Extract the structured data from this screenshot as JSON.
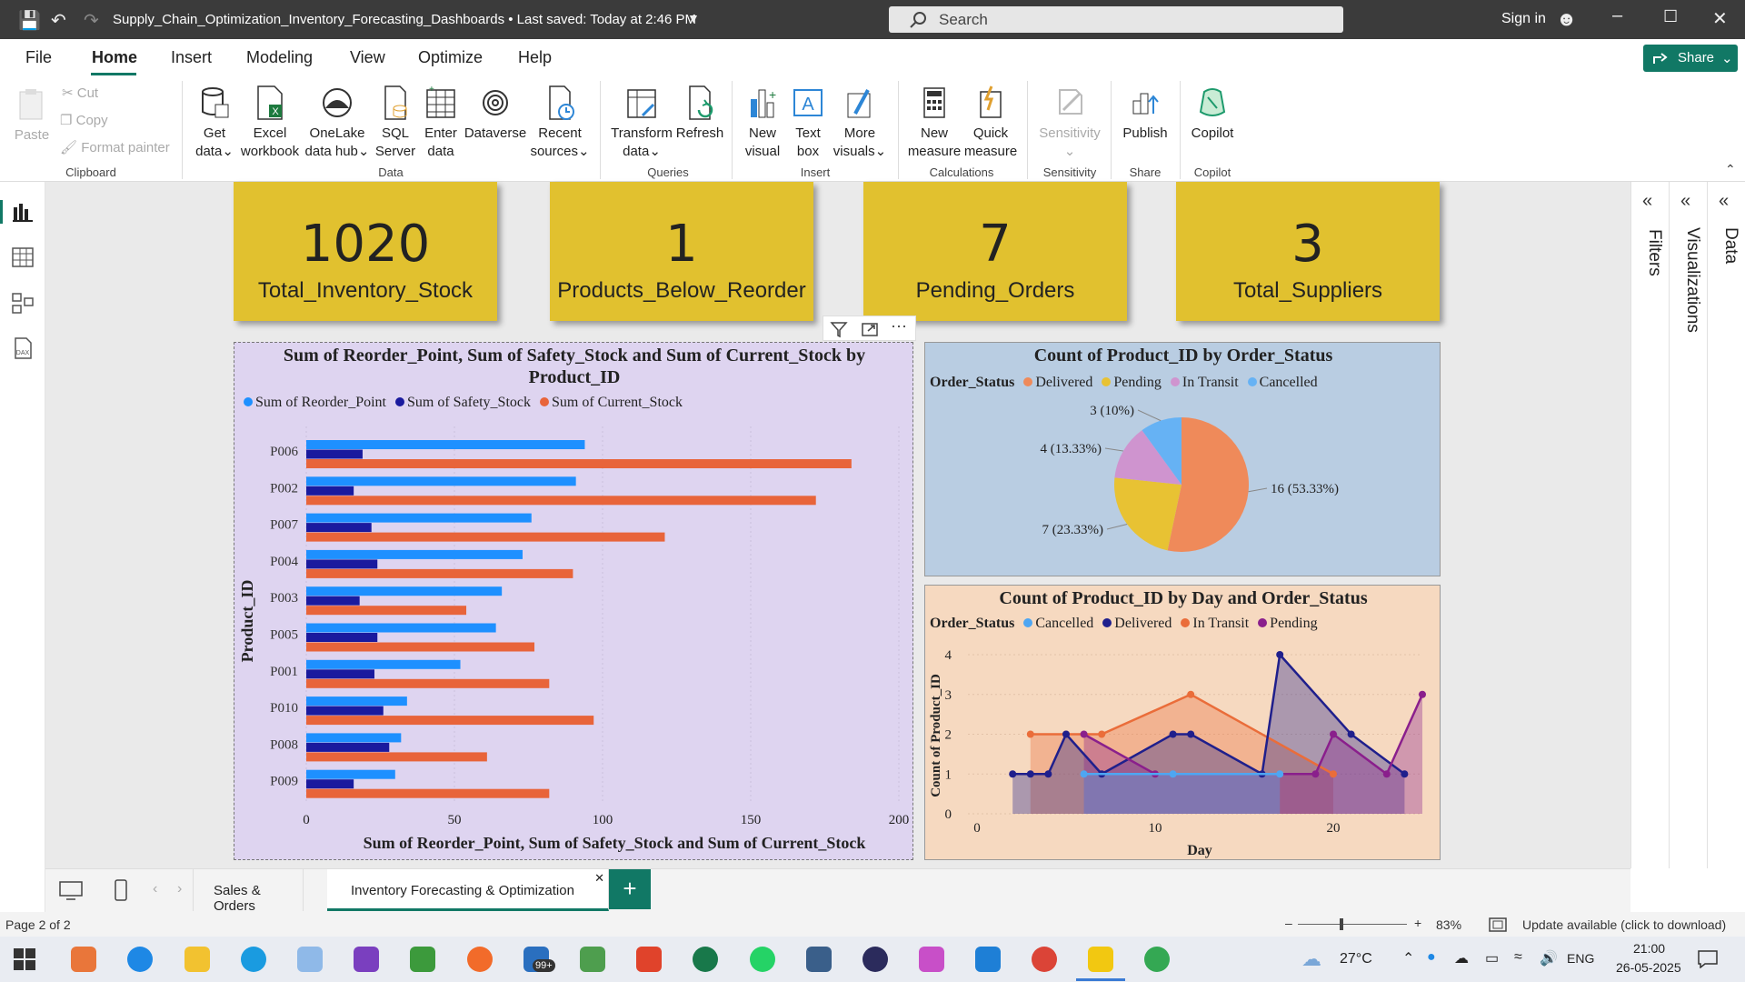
{
  "titlebar": {
    "file_title": "Supply_Chain_Optimization_Inventory_Forecasting_Dashboards • Last saved: Today at 2:46 PM",
    "search_placeholder": "Search",
    "signin": "Sign in"
  },
  "menu": {
    "items": [
      "File",
      "Home",
      "Insert",
      "Modeling",
      "View",
      "Optimize",
      "Help"
    ],
    "share": "Share"
  },
  "ribbon": {
    "clipboard": {
      "paste": "Paste",
      "cut": "Cut",
      "copy": "Copy",
      "format_painter": "Format painter",
      "group": "Clipboard"
    },
    "data": {
      "get_data": [
        "Get",
        "data"
      ],
      "excel": [
        "Excel",
        "workbook"
      ],
      "onelake": [
        "OneLake",
        "data hub"
      ],
      "sql": [
        "SQL",
        "Server"
      ],
      "enter": [
        "Enter",
        "data"
      ],
      "dataverse": [
        "Dataverse",
        ""
      ],
      "recent": [
        "Recent",
        "sources"
      ],
      "group": "Data"
    },
    "queries": {
      "transform": [
        "Transform",
        "data"
      ],
      "refresh": [
        "Refresh",
        ""
      ],
      "group": "Queries"
    },
    "insert": {
      "new_visual": [
        "New",
        "visual"
      ],
      "text_box": [
        "Text",
        "box"
      ],
      "more_visuals": [
        "More",
        "visuals"
      ],
      "group": "Insert"
    },
    "calculations": {
      "new_measure": [
        "New",
        "measure"
      ],
      "quick_measure": [
        "Quick",
        "measure"
      ],
      "group": "Calculations"
    },
    "sensitivity": {
      "label": "Sensitivity",
      "group": "Sensitivity"
    },
    "share": {
      "publish": "Publish",
      "group": "Share"
    },
    "copilot": {
      "label": "Copilot",
      "group": "Copilot"
    }
  },
  "kpis": [
    {
      "value": "1020",
      "label": "Total_Inventory_Stock"
    },
    {
      "value": "1",
      "label": "Products_Below_Reorder"
    },
    {
      "value": "7",
      "label": "Pending_Orders"
    },
    {
      "value": "3",
      "label": "Total_Suppliers"
    }
  ],
  "bar_chart": {
    "title_line1": "Sum of Reorder_Point, Sum of Safety_Stock and Sum of Current_Stock by",
    "title_line2": "Product_ID",
    "colors": {
      "reorder": "#1e90ff",
      "safety": "#1a1a9e",
      "current": "#e8643a"
    },
    "chart_data": {
      "type": "bar",
      "orientation": "horizontal",
      "categories": [
        "P006",
        "P002",
        "P007",
        "P004",
        "P003",
        "P005",
        "P001",
        "P010",
        "P008",
        "P009"
      ],
      "series": [
        {
          "name": "Sum of Reorder_Point",
          "values": [
            94,
            91,
            76,
            73,
            66,
            64,
            52,
            34,
            32,
            30
          ]
        },
        {
          "name": "Sum of Safety_Stock",
          "values": [
            19,
            16,
            22,
            24,
            18,
            24,
            23,
            26,
            28,
            16
          ]
        },
        {
          "name": "Sum of Current_Stock",
          "values": [
            184,
            172,
            121,
            90,
            54,
            77,
            82,
            97,
            61,
            82
          ]
        }
      ],
      "xlabel": "Sum of Reorder_Point, Sum of Safety_Stock and Sum of Current_Stock",
      "ylabel": "Product_ID",
      "xticks": [
        "0",
        "50",
        "100",
        "150",
        "200"
      ],
      "xlim": [
        0,
        200
      ]
    }
  },
  "pie_chart": {
    "title": "Count of Product_ID by Order_Status",
    "legend_title": "Order_Status",
    "chart_data": {
      "type": "pie",
      "slices": [
        {
          "name": "Delivered",
          "value": 16,
          "label": "16 (53.33%)",
          "color": "#ef8a5a"
        },
        {
          "name": "Pending",
          "value": 7,
          "label": "7 (23.33%)",
          "color": "#e8c233"
        },
        {
          "name": "In Transit",
          "value": 4,
          "label": "4 (13.33%)",
          "color": "#cf94cf"
        },
        {
          "name": "Cancelled",
          "value": 3,
          "label": "3 (10%)",
          "color": "#66b2f4"
        }
      ]
    }
  },
  "line_chart": {
    "title": "Count of Product_ID by Day and Order_Status",
    "legend_title": "Order_Status",
    "chart_data": {
      "type": "area",
      "xlabel": "Day",
      "ylabel": "Count of Product_ID",
      "xticks": [
        "0",
        "10",
        "20"
      ],
      "yticks": [
        "0",
        "1",
        "2",
        "3",
        "4"
      ],
      "xlim": [
        0,
        25
      ],
      "ylim": [
        0,
        4
      ],
      "series": [
        {
          "name": "Cancelled",
          "color": "#4ea6f2",
          "x": [
            6,
            11,
            17
          ],
          "y": [
            1,
            1,
            1
          ]
        },
        {
          "name": "Delivered",
          "color": "#1f1f8c",
          "x": [
            2,
            3,
            4,
            5,
            7,
            11,
            12,
            16,
            17,
            21,
            24
          ],
          "y": [
            1,
            1,
            1,
            2,
            1,
            2,
            2,
            1,
            4,
            2,
            1
          ]
        },
        {
          "name": "In Transit",
          "color": "#ea6d3a",
          "x": [
            3,
            5,
            7,
            12,
            20
          ],
          "y": [
            2,
            2,
            2,
            3,
            1
          ]
        },
        {
          "name": "Pending",
          "color": "#8a1f8c",
          "x": [
            6,
            10,
            19,
            20,
            23,
            25
          ],
          "y": [
            2,
            1,
            1,
            2,
            1,
            3
          ]
        }
      ]
    }
  },
  "panes": {
    "filters": "Filters",
    "visualizations": "Visualizations",
    "data": "Data"
  },
  "page_tabs": [
    "Sales & Orders",
    "Inventory Forecasting & Optimization"
  ],
  "status": {
    "page": "Page 2 of 2",
    "zoom": "83%",
    "update": "Update available (click to download)"
  },
  "taskbar": {
    "weather": "27°C",
    "lang": "ENG",
    "time": "21:00",
    "date": "26-05-2025",
    "badge": "99+"
  }
}
